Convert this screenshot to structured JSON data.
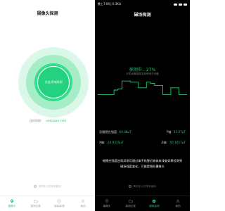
{
  "left": {
    "title": "摄像头探测",
    "radar_button": "点击开始探测",
    "device_label": "当前网络：",
    "device_value": "unknown ssid",
    "hint": "请勿在公共场所使用",
    "tabs": [
      {
        "label": "摄像头",
        "icon": "location-pin-icon",
        "active": true
      },
      {
        "label": "探测记录",
        "icon": "folder-icon",
        "active": false
      },
      {
        "label": "磁场探测",
        "icon": "compass-icon",
        "active": false
      },
      {
        "label": "我的",
        "icon": "user-icon",
        "active": false
      }
    ]
  },
  "right": {
    "status_time": "晚上7:04 | 0.3K/s",
    "title": "磁场探测",
    "progress": "探测中…27%",
    "sub": "手机远离磁铁及其他电子设备",
    "wave_values": [
      0.3,
      0.3,
      0.3,
      0.3,
      0.5,
      0.55,
      0.9,
      0.9,
      0.85,
      0.85,
      0.6,
      0.6,
      0.85,
      0.8,
      0.7,
      0.7,
      0.3,
      0.3,
      0.6,
      0.6,
      0.3,
      0.3
    ],
    "readings": {
      "total_label": "总磁感应强度:",
      "total_value": "64.08μT",
      "y_label": "Y轴:",
      "y_value": "33.07μT",
      "x_label": "X轴:",
      "x_value": "-24.9325μT",
      "z_label": "Z轴:",
      "z_value": "-50.1657μT"
    },
    "warning": "磁感应强度出现异常可通过拿手机靠近物体来排查如果检测到磁场强度变化，可能是隐形摄像头",
    "hint": "请勿在公共场所使用",
    "tabs": [
      {
        "label": "摄像头",
        "icon": "location-pin-icon",
        "active": false
      },
      {
        "label": "探测记录",
        "icon": "folder-icon",
        "active": false
      },
      {
        "label": "磁场探测",
        "icon": "compass-icon",
        "active": true
      },
      {
        "label": "我的",
        "icon": "user-icon",
        "active": false
      }
    ]
  },
  "colors": {
    "accent": "#2bc877",
    "radar_core": "#23d27e",
    "dark_bg": "#000000"
  }
}
